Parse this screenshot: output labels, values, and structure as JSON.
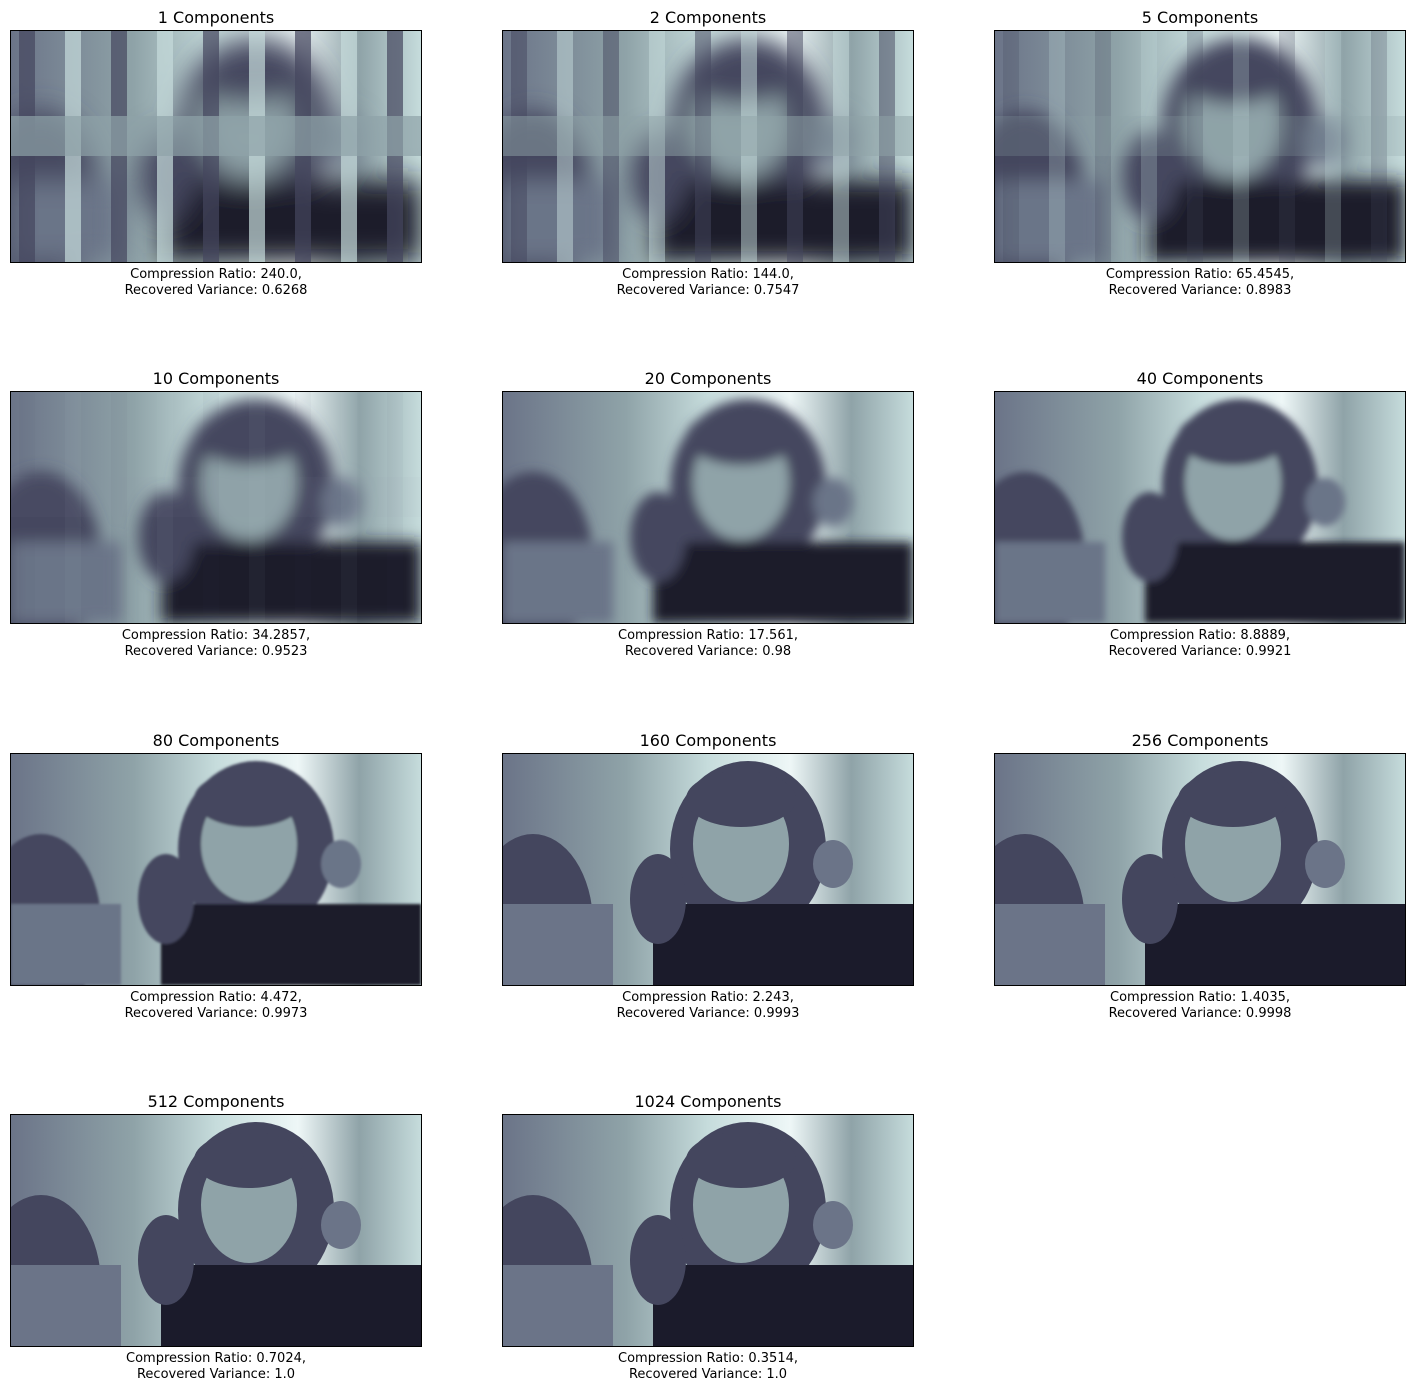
{
  "figure": {
    "panels": [
      {
        "title": "1 Components",
        "ratio_line": "Compression Ratio: 240.0,",
        "variance_line": "Recovered Variance: 0.6268",
        "components": 1
      },
      {
        "title": "2 Components",
        "ratio_line": "Compression Ratio: 144.0,",
        "variance_line": "Recovered Variance: 0.7547",
        "components": 2
      },
      {
        "title": "5 Components",
        "ratio_line": "Compression Ratio: 65.4545,",
        "variance_line": "Recovered Variance: 0.8983",
        "components": 5
      },
      {
        "title": "10 Components",
        "ratio_line": "Compression Ratio: 34.2857,",
        "variance_line": "Recovered Variance: 0.9523",
        "components": 10
      },
      {
        "title": "20 Components",
        "ratio_line": "Compression Ratio: 17.561,",
        "variance_line": "Recovered Variance: 0.98",
        "components": 20
      },
      {
        "title": "40 Components",
        "ratio_line": "Compression Ratio: 8.8889,",
        "variance_line": "Recovered Variance: 0.9921",
        "components": 40
      },
      {
        "title": "80 Components",
        "ratio_line": "Compression Ratio: 4.472,",
        "variance_line": "Recovered Variance: 0.9973",
        "components": 80
      },
      {
        "title": "160 Components",
        "ratio_line": "Compression Ratio: 2.243,",
        "variance_line": "Recovered Variance: 0.9993",
        "components": 160
      },
      {
        "title": "256 Components",
        "ratio_line": "Compression Ratio: 1.4035,",
        "variance_line": "Recovered Variance: 0.9998",
        "components": 256
      },
      {
        "title": "512 Components",
        "ratio_line": "Compression Ratio: 0.7024,",
        "variance_line": "Recovered Variance: 1.0",
        "components": 512
      },
      {
        "title": "1024 Components",
        "ratio_line": "Compression Ratio: 0.3514,",
        "variance_line": "Recovered Variance: 1.0",
        "components": 1024
      }
    ],
    "colormap": [
      "#1b1b2b",
      "#44465e",
      "#6b7488",
      "#8fa3a8",
      "#c6dcdc",
      "#eef7f7"
    ]
  }
}
